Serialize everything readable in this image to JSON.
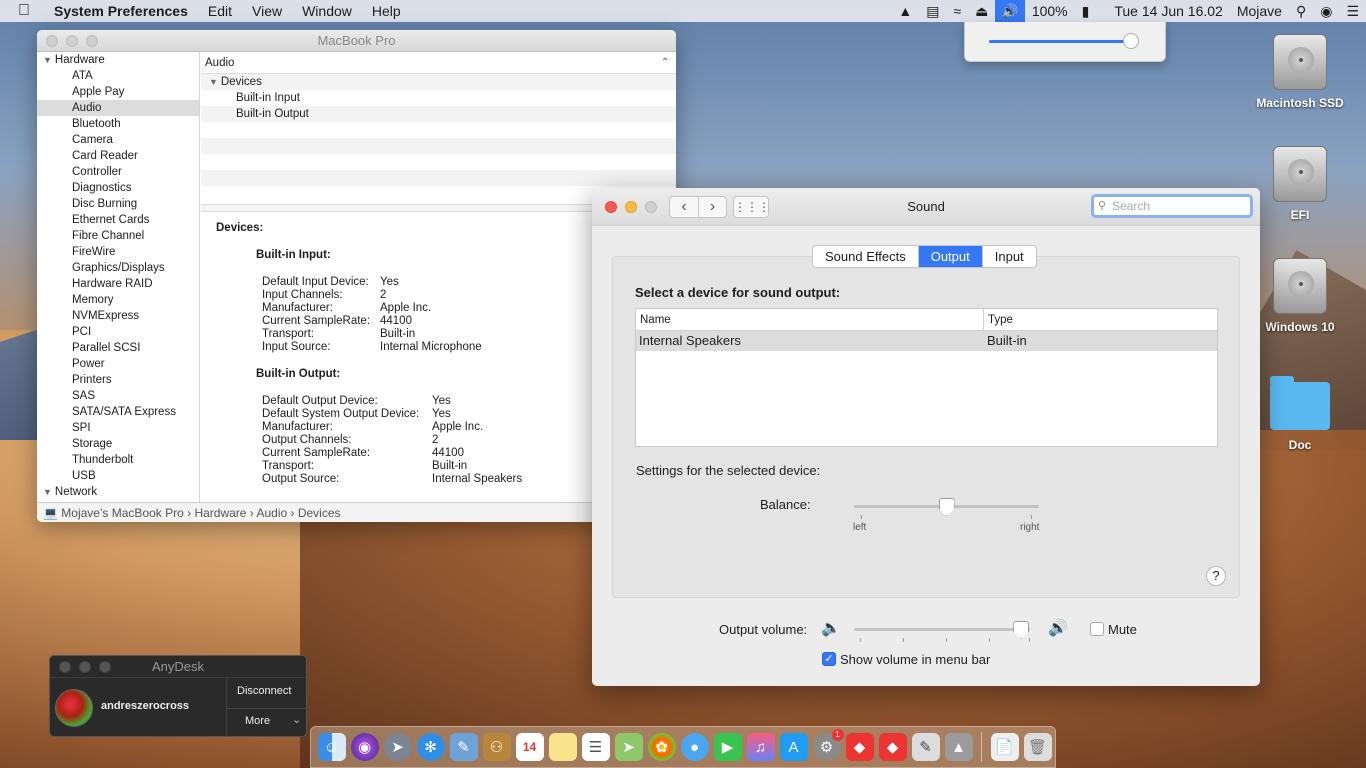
{
  "menubar": {
    "items": [
      "System Preferences",
      "Edit",
      "View",
      "Window",
      "Help"
    ],
    "battery": "100%",
    "datetime": "Tue 14 Jun  16.02",
    "user": "Mojave"
  },
  "volume_menu": {
    "level": 0.92
  },
  "desktop_icons": [
    "Macintosh SSD",
    "EFI",
    "Windows 10",
    "Doc"
  ],
  "sysinfo": {
    "title": "MacBook Pro",
    "sidebar": {
      "hardware": "Hardware",
      "items": [
        "ATA",
        "Apple Pay",
        "Audio",
        "Bluetooth",
        "Camera",
        "Card Reader",
        "Controller",
        "Diagnostics",
        "Disc Burning",
        "Ethernet Cards",
        "Fibre Channel",
        "FireWire",
        "Graphics/Displays",
        "Hardware RAID",
        "Memory",
        "NVMExpress",
        "PCI",
        "Parallel SCSI",
        "Power",
        "Printers",
        "SAS",
        "SATA/SATA Express",
        "SPI",
        "Storage",
        "Thunderbolt",
        "USB"
      ],
      "network": "Network"
    },
    "list_header": "Audio",
    "group": "Devices",
    "devices": [
      "Built-in Input",
      "Built-in Output"
    ],
    "detail": {
      "heading": "Devices:",
      "input_title": "Built-in Input:",
      "input_rows": [
        [
          "Default Input Device:",
          "Yes"
        ],
        [
          "Input Channels:",
          "2"
        ],
        [
          "Manufacturer:",
          "Apple Inc."
        ],
        [
          "Current SampleRate:",
          "44100"
        ],
        [
          "Transport:",
          "Built-in"
        ],
        [
          "Input Source:",
          "Internal Microphone"
        ]
      ],
      "output_title": "Built-in Output:",
      "output_rows": [
        [
          "Default Output Device:",
          "Yes"
        ],
        [
          "Default System Output Device:",
          "Yes"
        ],
        [
          "Manufacturer:",
          "Apple Inc."
        ],
        [
          "Output Channels:",
          "2"
        ],
        [
          "Current SampleRate:",
          "44100"
        ],
        [
          "Transport:",
          "Built-in"
        ],
        [
          "Output Source:",
          "Internal Speakers"
        ]
      ]
    },
    "breadcrumb": "Mojave’s MacBook Pro  ›  Hardware  ›  Audio  ›  Devices"
  },
  "sound": {
    "title": "Sound",
    "search_placeholder": "Search",
    "tabs": [
      "Sound Effects",
      "Output",
      "Input"
    ],
    "active_tab": "Output",
    "select_label": "Select a device for sound output:",
    "columns": [
      "Name",
      "Type"
    ],
    "rows": [
      [
        "Internal Speakers",
        "Built-in"
      ]
    ],
    "settings_label": "Settings for the selected device:",
    "balance_label": "Balance:",
    "balance_left": "left",
    "balance_right": "right",
    "balance_value": 0.5,
    "help": "?",
    "output_volume_label": "Output volume:",
    "output_volume": 0.95,
    "mute_label": "Mute",
    "mute_checked": false,
    "show_volume_label": "Show volume in menu bar",
    "show_volume_checked": true
  },
  "anydesk": {
    "title": "AnyDesk",
    "user": "andreszerocross",
    "disconnect": "Disconnect",
    "more": "More"
  },
  "dock": {
    "calendar_day": "14",
    "system_prefs_badge": "1"
  }
}
